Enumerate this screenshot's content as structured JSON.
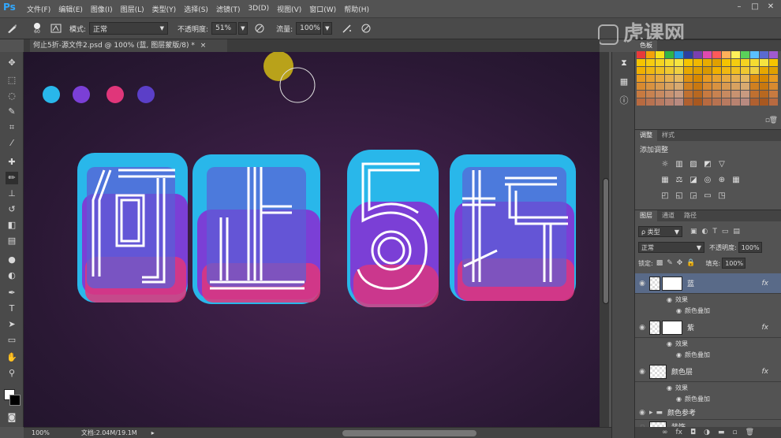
{
  "app": {
    "logo": "Ps"
  },
  "menu": [
    "文件(F)",
    "编辑(E)",
    "图像(I)",
    "图层(L)",
    "类型(Y)",
    "选择(S)",
    "滤镜(T)",
    "3D(D)",
    "视图(V)",
    "窗口(W)",
    "帮助(H)"
  ],
  "options": {
    "brush_size": "60",
    "mode_label": "模式:",
    "mode_value": "正常",
    "opacity_label": "不透明度:",
    "opacity_value": "51%",
    "flow_label": "流量:",
    "flow_value": "100%"
  },
  "watermark": "虎课网",
  "document": {
    "tab_title": "何止5折-源文件2.psd @ 100% (蓝, 图层蒙版/8) *"
  },
  "status": {
    "zoom": "100%",
    "doc_info": "文档:2.04M/19.1M"
  },
  "artwork": {
    "headline": "何止5折",
    "dot_colors": [
      "#29b7ea",
      "#7b3fd6",
      "#e0367a",
      "#5b3fc8"
    ],
    "brush_cursor_color": "#b9a21a"
  },
  "panels": {
    "swatches_tab": "色板",
    "adjust_tabs": [
      "调整",
      "样式"
    ],
    "adjust_title": "添加调整",
    "layers_tabs": [
      "图层",
      "通道",
      "路径"
    ],
    "kind_filter": "ρ 类型",
    "blend_mode": "正常",
    "opacity_label": "不透明度:",
    "opacity_value": "100%",
    "lock_label": "锁定:",
    "fill_label": "填充:",
    "fill_value": "100%",
    "layers": [
      {
        "name": "蓝",
        "effects": "效果",
        "effect_item": "颜色叠加",
        "selected": true
      },
      {
        "name": "紫",
        "effects": "效果",
        "effect_item": "颜色叠加",
        "selected": false
      },
      {
        "name": "颜色层",
        "effects": "效果",
        "effect_item": "颜色叠加",
        "selected": false
      },
      {
        "name": "颜色参考",
        "effects": "",
        "effect_item": "",
        "selected": false
      },
      {
        "name": "装饰",
        "effects": "",
        "effect_item": "",
        "selected": false
      }
    ]
  }
}
